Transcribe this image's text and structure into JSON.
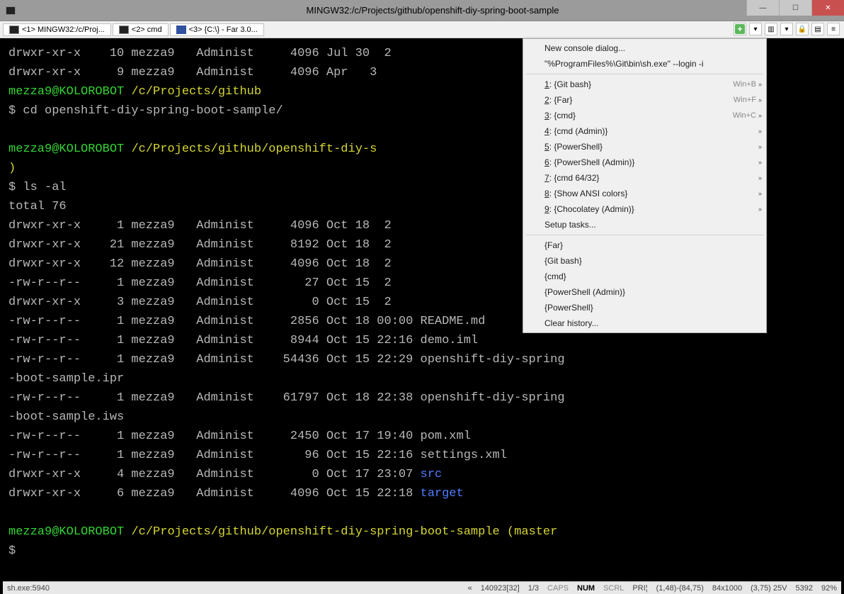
{
  "window": {
    "title": "MINGW32:/c/Projects/github/openshift-diy-spring-boot-sample"
  },
  "tabs": [
    {
      "label": "<1> MINGW32:/c/Proj...",
      "icon": "term"
    },
    {
      "label": "<2> cmd",
      "icon": "term"
    },
    {
      "label": "<3> {C:\\} - Far 3.0...",
      "icon": "far"
    }
  ],
  "terminal": {
    "lines": [
      {
        "segs": [
          {
            "t": "drwxr-xr-x    10 mezza9   Administ     4096 Jul 30  2",
            "c": ""
          }
        ]
      },
      {
        "segs": [
          {
            "t": "drwxr-xr-x     9 mezza9   Administ     4096 Apr   3",
            "c": ""
          }
        ]
      },
      {
        "segs": [
          {
            "t": "mezza9@KOLOROBOT ",
            "c": "green"
          },
          {
            "t": "/c/Projects/github",
            "c": "yellow"
          }
        ]
      },
      {
        "segs": [
          {
            "t": "$ cd openshift-diy-spring-boot-sample/",
            "c": ""
          }
        ]
      },
      {
        "segs": [
          {
            "t": " ",
            "c": ""
          }
        ]
      },
      {
        "segs": [
          {
            "t": "mezza9@KOLOROBOT ",
            "c": "green"
          },
          {
            "t": "/c/Projects/github/openshift-diy-s",
            "c": "yellow"
          }
        ]
      },
      {
        "segs": [
          {
            "t": ")",
            "c": "yellow"
          }
        ]
      },
      {
        "segs": [
          {
            "t": "$ ls -al",
            "c": ""
          }
        ]
      },
      {
        "segs": [
          {
            "t": "total 76",
            "c": ""
          }
        ]
      },
      {
        "segs": [
          {
            "t": "drwxr-xr-x     1 mezza9   Administ     4096 Oct 18  2",
            "c": ""
          }
        ]
      },
      {
        "segs": [
          {
            "t": "drwxr-xr-x    21 mezza9   Administ     8192 Oct 18  2",
            "c": ""
          }
        ]
      },
      {
        "segs": [
          {
            "t": "drwxr-xr-x    12 mezza9   Administ     4096 Oct 18  2",
            "c": ""
          }
        ]
      },
      {
        "segs": [
          {
            "t": "-rw-r--r--     1 mezza9   Administ       27 Oct 15  2",
            "c": ""
          }
        ]
      },
      {
        "segs": [
          {
            "t": "drwxr-xr-x     3 mezza9   Administ        0 Oct 15  2",
            "c": ""
          }
        ]
      },
      {
        "segs": [
          {
            "t": "-rw-r--r--     1 mezza9   Administ     2856 Oct 18 00:00 README.md",
            "c": ""
          }
        ]
      },
      {
        "segs": [
          {
            "t": "-rw-r--r--     1 mezza9   Administ     8944 Oct 15 22:16 demo.iml",
            "c": ""
          }
        ]
      },
      {
        "segs": [
          {
            "t": "-rw-r--r--     1 mezza9   Administ    54436 Oct 15 22:29 openshift-diy-spring",
            "c": ""
          }
        ]
      },
      {
        "segs": [
          {
            "t": "-boot-sample.ipr",
            "c": ""
          }
        ]
      },
      {
        "segs": [
          {
            "t": "-rw-r--r--     1 mezza9   Administ    61797 Oct 18 22:38 openshift-diy-spring",
            "c": ""
          }
        ]
      },
      {
        "segs": [
          {
            "t": "-boot-sample.iws",
            "c": ""
          }
        ]
      },
      {
        "segs": [
          {
            "t": "-rw-r--r--     1 mezza9   Administ     2450 Oct 17 19:40 pom.xml",
            "c": ""
          }
        ]
      },
      {
        "segs": [
          {
            "t": "-rw-r--r--     1 mezza9   Administ       96 Oct 15 22:16 settings.xml",
            "c": ""
          }
        ]
      },
      {
        "segs": [
          {
            "t": "drwxr-xr-x     4 mezza9   Administ        0 Oct 17 23:07 ",
            "c": ""
          },
          {
            "t": "src",
            "c": "blue"
          }
        ]
      },
      {
        "segs": [
          {
            "t": "drwxr-xr-x     6 mezza9   Administ     4096 Oct 15 22:18 ",
            "c": ""
          },
          {
            "t": "target",
            "c": "blue"
          }
        ]
      },
      {
        "segs": [
          {
            "t": " ",
            "c": ""
          }
        ]
      },
      {
        "segs": [
          {
            "t": "mezza9@KOLOROBOT ",
            "c": "green"
          },
          {
            "t": "/c/Projects/github/openshift-diy-spring-boot-sample (master",
            "c": "yellow"
          }
        ]
      },
      {
        "segs": [
          {
            "t": "$",
            "c": ""
          }
        ]
      }
    ]
  },
  "menu": {
    "items_top": [
      {
        "label": "New console dialog...",
        "arrow": false
      },
      {
        "label": "\"%ProgramFiles%\\Git\\bin\\sh.exe\" --login -i",
        "arrow": false
      }
    ],
    "tasks": [
      {
        "n": "1",
        "label": "{Git bash}",
        "shortcut": "Win+B",
        "arrow": true
      },
      {
        "n": "2",
        "label": "{Far}",
        "shortcut": "Win+F",
        "arrow": true
      },
      {
        "n": "3",
        "label": "{cmd}",
        "shortcut": "Win+C",
        "arrow": true
      },
      {
        "n": "4",
        "label": "{cmd (Admin)}",
        "shortcut": "",
        "arrow": true
      },
      {
        "n": "5",
        "label": "{PowerShell}",
        "shortcut": "",
        "arrow": true
      },
      {
        "n": "6",
        "label": "{PowerShell (Admin)}",
        "shortcut": "",
        "arrow": true
      },
      {
        "n": "7",
        "label": "{cmd 64/32}",
        "shortcut": "",
        "arrow": true
      },
      {
        "n": "8",
        "label": "{Show ANSI colors}",
        "shortcut": "",
        "arrow": true
      },
      {
        "n": "9",
        "label": "{Chocolatey (Admin)}",
        "shortcut": "",
        "arrow": true
      }
    ],
    "setup_tasks": "Setup tasks...",
    "history": [
      "{Far}",
      "{Git bash}",
      "{cmd}",
      "{PowerShell (Admin)}",
      "{PowerShell}"
    ],
    "clear_history": "Clear history..."
  },
  "status": {
    "left": "sh.exe:5940",
    "scroll": "«",
    "id": "140923[32]",
    "pos": "1/3",
    "caps": "CAPS",
    "num": "NUM",
    "scrl": "SCRL",
    "pri": "PRI¦",
    "coord1": "(1,48)-(84,75)",
    "dim": "84x1000",
    "coord2": "(3,75) 25V",
    "mem": "5392",
    "pct": "92%"
  }
}
